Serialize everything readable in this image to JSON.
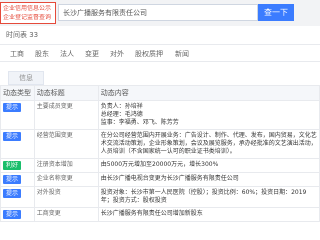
{
  "topbar": {
    "left_box": [
      "企业信用信息公示",
      "企业登记监督查询"
    ],
    "search_value": "长沙广播服务有限责任公司",
    "search_button": "查一下"
  },
  "subtitle": "时间表 33",
  "tabs": [
    "工商",
    "股东",
    "法人",
    "变更",
    "对外",
    "股权质押",
    "新闻"
  ],
  "chip": "信息",
  "table": {
    "headers": [
      "动态类型",
      "动态标题",
      "动态内容"
    ],
    "rows": [
      {
        "tag": {
          "label": "提示",
          "color": "blue"
        },
        "title": "主要成员变更",
        "content": [
          "负责人：孙培祥",
          "总经理：毛鸿德",
          "监事：李福勇、邓飞、陈芳芳"
        ]
      },
      {
        "tag": {
          "label": "提示",
          "color": "blue"
        },
        "title": "经营范围变更",
        "content": [
          "在分公司经营范围内开展业务：广告设计、制作、代理、发布，国内贸易，文化艺术交流活动策划，企业形象策划，会议及展览服务，承办经批准的文艺演出活动，人员培训（不含国家统一认可的职业证书类培训）。"
        ]
      },
      {
        "tag": {
          "label": "利好",
          "color": "green"
        },
        "title": "注册资本增加",
        "content": [
          "由5000万元增加至20000万元，增长300%"
        ]
      },
      {
        "tag": {
          "label": "提示",
          "color": "blue"
        },
        "title": "企业名称变更",
        "content": [
          "由长沙广播电视台变更为长沙广播服务有限责任公司"
        ]
      },
      {
        "tag": {
          "label": "提示",
          "color": "blue"
        },
        "title": "对外投资",
        "content": [
          "投资对象：长沙市第一人民医院（控股）；投资比例：60%；投资日期：2019年；投资方式：股权投资"
        ]
      },
      {
        "tag": {
          "label": "提示",
          "color": "blue"
        },
        "title": "工商变更",
        "content": [
          "长沙广播服务有限责任公司增加新股东"
        ]
      }
    ]
  }
}
